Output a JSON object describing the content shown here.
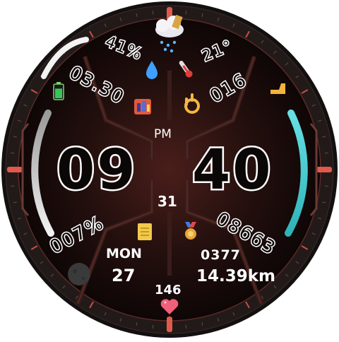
{
  "time": {
    "hours": "09",
    "minutes": "40",
    "ampm": "PM",
    "date_day": "31"
  },
  "weather": {
    "humidity": "41%",
    "temperature": "21°"
  },
  "battery": {
    "value": "03.30",
    "level": 0.8
  },
  "complication_right_top": {
    "value": "016"
  },
  "complication_left_bottom": {
    "value": "007%"
  },
  "steps": {
    "value": "08663"
  },
  "calendar": {
    "weekday": "MON",
    "day": "27"
  },
  "activity": {
    "calories": "0377",
    "distance": "14.39km"
  },
  "heart_rate": {
    "value": "146"
  },
  "colors": {
    "face_bg": "#1a0a09",
    "bezel": "#1e1716",
    "accent_red": "#d9574a",
    "left_bar": "#e6e6e6",
    "right_bar": "#4fd3d8",
    "battery_green": "#34c759"
  }
}
